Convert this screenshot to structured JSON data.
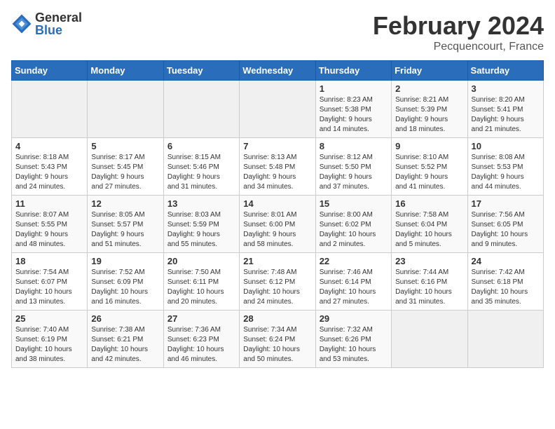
{
  "header": {
    "logo_general": "General",
    "logo_blue": "Blue",
    "month_title": "February 2024",
    "location": "Pecquencourt, France"
  },
  "days_of_week": [
    "Sunday",
    "Monday",
    "Tuesday",
    "Wednesday",
    "Thursday",
    "Friday",
    "Saturday"
  ],
  "weeks": [
    [
      {
        "day": "",
        "info": ""
      },
      {
        "day": "",
        "info": ""
      },
      {
        "day": "",
        "info": ""
      },
      {
        "day": "",
        "info": ""
      },
      {
        "day": "1",
        "info": "Sunrise: 8:23 AM\nSunset: 5:38 PM\nDaylight: 9 hours\nand 14 minutes."
      },
      {
        "day": "2",
        "info": "Sunrise: 8:21 AM\nSunset: 5:39 PM\nDaylight: 9 hours\nand 18 minutes."
      },
      {
        "day": "3",
        "info": "Sunrise: 8:20 AM\nSunset: 5:41 PM\nDaylight: 9 hours\nand 21 minutes."
      }
    ],
    [
      {
        "day": "4",
        "info": "Sunrise: 8:18 AM\nSunset: 5:43 PM\nDaylight: 9 hours\nand 24 minutes."
      },
      {
        "day": "5",
        "info": "Sunrise: 8:17 AM\nSunset: 5:45 PM\nDaylight: 9 hours\nand 27 minutes."
      },
      {
        "day": "6",
        "info": "Sunrise: 8:15 AM\nSunset: 5:46 PM\nDaylight: 9 hours\nand 31 minutes."
      },
      {
        "day": "7",
        "info": "Sunrise: 8:13 AM\nSunset: 5:48 PM\nDaylight: 9 hours\nand 34 minutes."
      },
      {
        "day": "8",
        "info": "Sunrise: 8:12 AM\nSunset: 5:50 PM\nDaylight: 9 hours\nand 37 minutes."
      },
      {
        "day": "9",
        "info": "Sunrise: 8:10 AM\nSunset: 5:52 PM\nDaylight: 9 hours\nand 41 minutes."
      },
      {
        "day": "10",
        "info": "Sunrise: 8:08 AM\nSunset: 5:53 PM\nDaylight: 9 hours\nand 44 minutes."
      }
    ],
    [
      {
        "day": "11",
        "info": "Sunrise: 8:07 AM\nSunset: 5:55 PM\nDaylight: 9 hours\nand 48 minutes."
      },
      {
        "day": "12",
        "info": "Sunrise: 8:05 AM\nSunset: 5:57 PM\nDaylight: 9 hours\nand 51 minutes."
      },
      {
        "day": "13",
        "info": "Sunrise: 8:03 AM\nSunset: 5:59 PM\nDaylight: 9 hours\nand 55 minutes."
      },
      {
        "day": "14",
        "info": "Sunrise: 8:01 AM\nSunset: 6:00 PM\nDaylight: 9 hours\nand 58 minutes."
      },
      {
        "day": "15",
        "info": "Sunrise: 8:00 AM\nSunset: 6:02 PM\nDaylight: 10 hours\nand 2 minutes."
      },
      {
        "day": "16",
        "info": "Sunrise: 7:58 AM\nSunset: 6:04 PM\nDaylight: 10 hours\nand 5 minutes."
      },
      {
        "day": "17",
        "info": "Sunrise: 7:56 AM\nSunset: 6:05 PM\nDaylight: 10 hours\nand 9 minutes."
      }
    ],
    [
      {
        "day": "18",
        "info": "Sunrise: 7:54 AM\nSunset: 6:07 PM\nDaylight: 10 hours\nand 13 minutes."
      },
      {
        "day": "19",
        "info": "Sunrise: 7:52 AM\nSunset: 6:09 PM\nDaylight: 10 hours\nand 16 minutes."
      },
      {
        "day": "20",
        "info": "Sunrise: 7:50 AM\nSunset: 6:11 PM\nDaylight: 10 hours\nand 20 minutes."
      },
      {
        "day": "21",
        "info": "Sunrise: 7:48 AM\nSunset: 6:12 PM\nDaylight: 10 hours\nand 24 minutes."
      },
      {
        "day": "22",
        "info": "Sunrise: 7:46 AM\nSunset: 6:14 PM\nDaylight: 10 hours\nand 27 minutes."
      },
      {
        "day": "23",
        "info": "Sunrise: 7:44 AM\nSunset: 6:16 PM\nDaylight: 10 hours\nand 31 minutes."
      },
      {
        "day": "24",
        "info": "Sunrise: 7:42 AM\nSunset: 6:18 PM\nDaylight: 10 hours\nand 35 minutes."
      }
    ],
    [
      {
        "day": "25",
        "info": "Sunrise: 7:40 AM\nSunset: 6:19 PM\nDaylight: 10 hours\nand 38 minutes."
      },
      {
        "day": "26",
        "info": "Sunrise: 7:38 AM\nSunset: 6:21 PM\nDaylight: 10 hours\nand 42 minutes."
      },
      {
        "day": "27",
        "info": "Sunrise: 7:36 AM\nSunset: 6:23 PM\nDaylight: 10 hours\nand 46 minutes."
      },
      {
        "day": "28",
        "info": "Sunrise: 7:34 AM\nSunset: 6:24 PM\nDaylight: 10 hours\nand 50 minutes."
      },
      {
        "day": "29",
        "info": "Sunrise: 7:32 AM\nSunset: 6:26 PM\nDaylight: 10 hours\nand 53 minutes."
      },
      {
        "day": "",
        "info": ""
      },
      {
        "day": "",
        "info": ""
      }
    ]
  ]
}
